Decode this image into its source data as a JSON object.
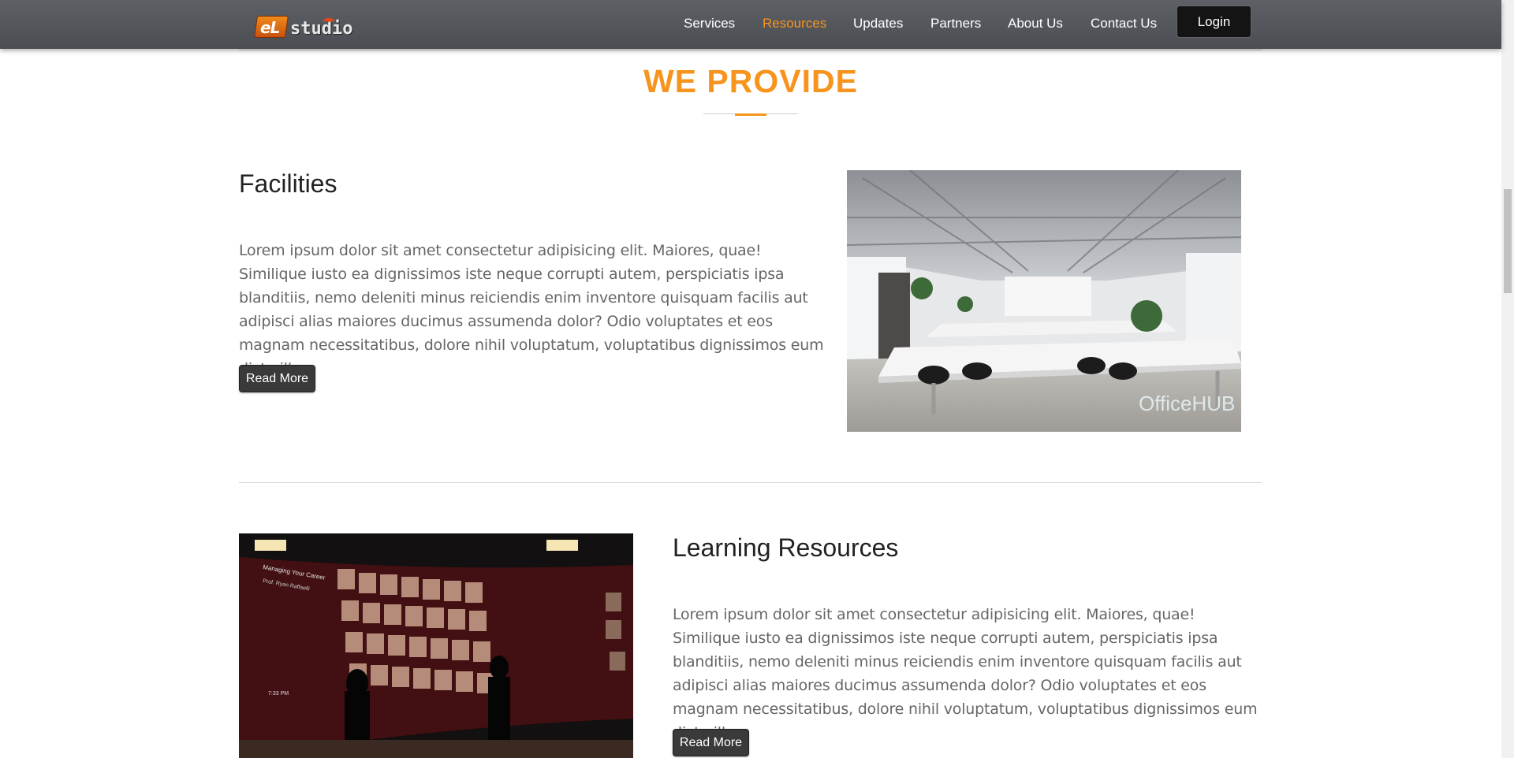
{
  "brand": {
    "badge_text": "eL",
    "name": "studio"
  },
  "nav": {
    "items": [
      {
        "label": "Services",
        "active": false
      },
      {
        "label": "Resources",
        "active": true
      },
      {
        "label": "Updates",
        "active": false
      },
      {
        "label": "Partners",
        "active": false
      },
      {
        "label": "About Us",
        "active": false
      },
      {
        "label": "Contact Us",
        "active": false
      }
    ],
    "login_label": "Login"
  },
  "section": {
    "title": "WE PROVIDE"
  },
  "blocks": [
    {
      "heading": "Facilities",
      "text": "Lorem ipsum dolor sit amet consectetur adipisicing elit. Maiores, quae! Similique iusto ea dignissimos iste neque corrupti autem, perspiciatis ipsa blanditiis, nemo deleniti minus reiciendis enim inventore quisquam facilis aut adipisci alias maiores ducimus assumenda dolor? Odio voluptates et eos magnam necessitatibus, dolore nihil voluptatum, voluptatibus dignissimos eum dicta illo.",
      "button_label": "Read More",
      "image_watermark": "OfficeHUB"
    },
    {
      "heading": "Learning Resources",
      "text": "Lorem ipsum dolor sit amet consectetur adipisicing elit. Maiores, quae! Similique iusto ea dignissimos iste neque corrupti autem, perspiciatis ipsa blanditiis, nemo deleniti minus reiciendis enim inventore quisquam facilis aut adipisci alias maiores ducimus assumenda dolor? Odio voluptates et eos magnam necessitatibus, dolore nihil voluptatum, voluptatibus dignissimos eum dicta illo.",
      "button_label": "Read More",
      "image_caption": "Managing Your Career",
      "image_subcaption": "Prof. Ryan Raffaelli",
      "image_time": "7:33 PM"
    }
  ],
  "colors": {
    "accent": "#f7941d",
    "navbar": "#54585d",
    "button": "#3a3a3a"
  }
}
